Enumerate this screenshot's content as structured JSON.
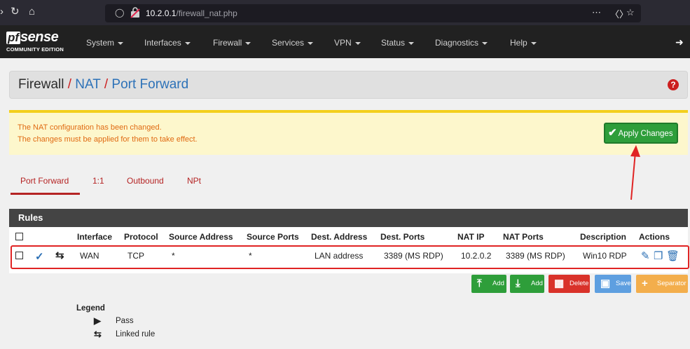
{
  "browser": {
    "url_host": "10.2.0.1",
    "url_path": "/firewall_nat.php",
    "icons": [
      "back-icon",
      "reload-icon",
      "home-icon",
      "shield-icon",
      "insecure-lock-icon",
      "more-icon",
      "pocket-icon",
      "star-icon"
    ]
  },
  "navbar": {
    "logo_pf": "pf",
    "logo_sense": "sense",
    "logo_edition": "COMMUNITY EDITION",
    "menu": [
      {
        "label": "System"
      },
      {
        "label": "Interfaces"
      },
      {
        "label": "Firewall"
      },
      {
        "label": "Services"
      },
      {
        "label": "VPN"
      },
      {
        "label": "Status"
      },
      {
        "label": "Diagnostics"
      },
      {
        "label": "Help"
      }
    ]
  },
  "breadcrumb": {
    "root": "Firewall",
    "sep": "/",
    "section": "NAT",
    "page": "Port Forward"
  },
  "alert": {
    "line1": "The NAT configuration has been changed.",
    "line2": "The changes must be applied for them to take effect.",
    "apply_label": "Apply Changes"
  },
  "tabs": [
    {
      "label": "Port Forward",
      "active": true
    },
    {
      "label": "1:1",
      "active": false
    },
    {
      "label": "Outbound",
      "active": false
    },
    {
      "label": "NPt",
      "active": false
    }
  ],
  "rules": {
    "title": "Rules",
    "columns": [
      "Interface",
      "Protocol",
      "Source Address",
      "Source Ports",
      "Dest. Address",
      "Dest. Ports",
      "NAT IP",
      "NAT Ports",
      "Description",
      "Actions"
    ],
    "rows": [
      {
        "interface": "WAN",
        "protocol": "TCP",
        "source_address": "*",
        "source_ports": "*",
        "dest_address": "LAN address",
        "dest_ports": "3389 (MS RDP)",
        "nat_ip": "10.2.0.2",
        "nat_ports": "3389 (MS RDP)",
        "description": "Win10 RDP"
      }
    ]
  },
  "buttons": {
    "add_top": "Add",
    "add_bottom": "Add",
    "delete": "Delete",
    "save": "Save",
    "separator": "Separator"
  },
  "legend": {
    "title": "Legend",
    "items": [
      {
        "label": "Pass",
        "icon": "play-icon"
      },
      {
        "label": "Linked rule",
        "icon": "shuffle-icon"
      }
    ]
  },
  "colors": {
    "navbar": "#212121",
    "accent_red": "#b52424",
    "link_blue": "#2d72b8",
    "success_green": "#2e9e3a",
    "alert_bg": "#fdf7cc",
    "alert_text": "#e06a12"
  }
}
